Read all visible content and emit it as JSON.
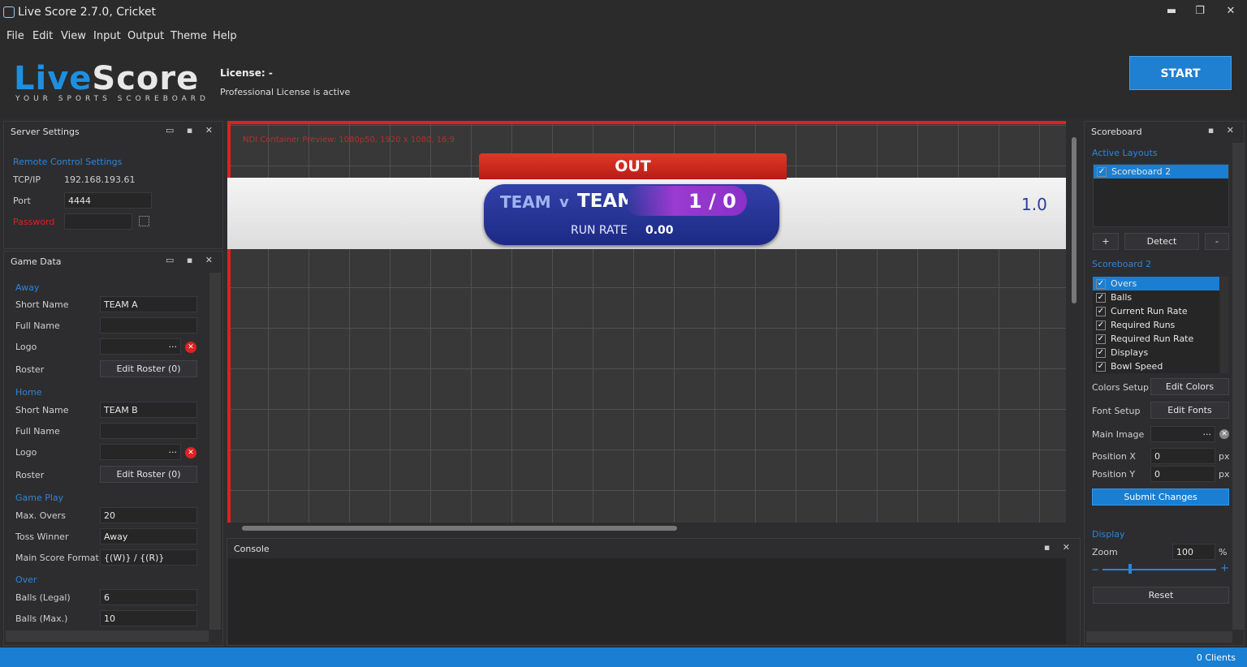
{
  "window": {
    "title": "Live Score 2.7.0, Cricket",
    "minimize": "▬",
    "maximize": "❐",
    "close": "✕"
  },
  "menu": [
    "File",
    "Edit",
    "View",
    "Input",
    "Output",
    "Theme",
    "Help"
  ],
  "header": {
    "logo_a": "Live",
    "logo_b": "Score",
    "tagline": "YOUR SPORTS SCOREBOARD",
    "license_label": "License: -",
    "license_status": "Professional License is active",
    "start_label": "START"
  },
  "server": {
    "title": "Server Settings",
    "section": "Remote Control Settings",
    "tcp_label": "TCP/IP",
    "tcp_value": "192.168.193.61",
    "port_label": "Port",
    "port_value": "4444",
    "password_label": "Password",
    "password_value": ""
  },
  "game": {
    "title": "Game Data",
    "away": "Away",
    "home": "Home",
    "short_name": "Short Name",
    "full_name": "Full Name",
    "logo": "Logo",
    "roster": "Roster",
    "edit_roster": "Edit Roster (0)",
    "away_short": "TEAM A",
    "home_short": "TEAM B",
    "game_play": "Game Play",
    "max_overs_label": "Max. Overs",
    "max_overs": "20",
    "toss_label": "Toss Winner",
    "toss": "Away",
    "format_label": "Main Score Format",
    "format": "{(W)} / {(R)}",
    "over": "Over",
    "balls_legal_label": "Balls (Legal)",
    "balls_legal": "6",
    "balls_max_label": "Balls (Max.)",
    "balls_max": "10",
    "ellipsis": "···",
    "remove": "✕"
  },
  "preview": {
    "overlay_text": "NDI Container Preview: 1080p50, 1920 x 1080, 16:9",
    "out": "OUT",
    "team_a": "TEAM",
    "vs": "v",
    "team_b": "TEAM",
    "score": "1 / 0",
    "run_rate_label": "RUN RATE",
    "run_rate": "0.00",
    "overs": "1.0"
  },
  "console": {
    "title": "Console"
  },
  "scoreboard": {
    "title": "Scoreboard",
    "active_layouts": "Active Layouts",
    "layout": "Scoreboard 2",
    "add": "+",
    "detect": "Detect",
    "remove": "-",
    "section": "Scoreboard 2",
    "items": [
      "Overs",
      "Balls",
      "Current Run Rate",
      "Required Runs",
      "Required Run Rate",
      "Displays",
      "Bowl Speed"
    ],
    "colors_label": "Colors Setup",
    "colors_btn": "Edit Colors",
    "font_label": "Font Setup",
    "font_btn": "Edit Fonts",
    "main_image": "Main Image",
    "ellipsis": "···",
    "posx_label": "Position X",
    "posx": "0",
    "posy_label": "Position Y",
    "posy": "0",
    "px": "px",
    "submit": "Submit Changes",
    "display": "Display",
    "zoom_label": "Zoom",
    "zoom": "100",
    "percent": "%",
    "reset": "Reset"
  },
  "status": {
    "clients": "0 Clients"
  },
  "colors": {
    "accent": "#1f7fd1",
    "red": "#d22222",
    "board_blue": "#2a3d9e"
  }
}
